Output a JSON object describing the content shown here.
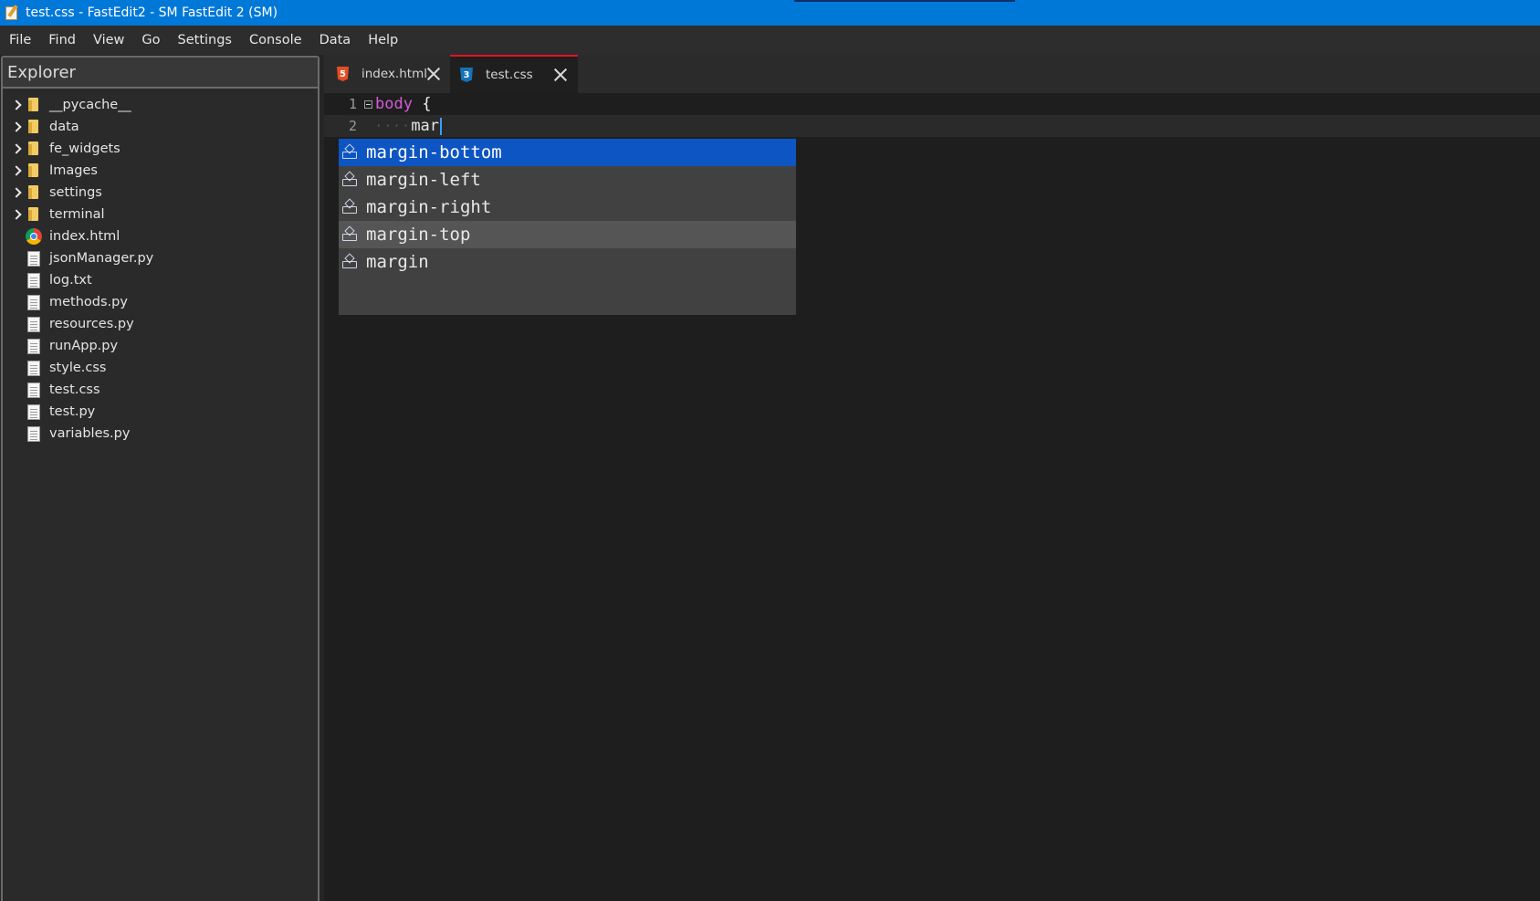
{
  "window": {
    "title": "test.css - FastEdit2 - SM FastEdit 2 (SM)",
    "title_bar_color": "#0078d7"
  },
  "menu": {
    "items": [
      "File",
      "Find",
      "View",
      "Go",
      "Settings",
      "Console",
      "Data",
      "Help"
    ]
  },
  "explorer": {
    "title": "Explorer",
    "folders": [
      "__pycache__",
      "data",
      "fe_widgets",
      "Images",
      "settings",
      "terminal"
    ],
    "files": [
      {
        "name": "index.html",
        "icon": "chrome-icon"
      },
      {
        "name": "jsonManager.py",
        "icon": "file-icon"
      },
      {
        "name": "log.txt",
        "icon": "file-icon"
      },
      {
        "name": "methods.py",
        "icon": "file-icon"
      },
      {
        "name": "resources.py",
        "icon": "file-icon"
      },
      {
        "name": "runApp.py",
        "icon": "file-icon"
      },
      {
        "name": "style.css",
        "icon": "file-icon"
      },
      {
        "name": "test.css",
        "icon": "file-icon"
      },
      {
        "name": "test.py",
        "icon": "file-icon"
      },
      {
        "name": "variables.py",
        "icon": "file-icon"
      }
    ]
  },
  "tabs": [
    {
      "label": "index.html",
      "icon": "html5-icon",
      "active": false
    },
    {
      "label": "test.css",
      "icon": "css3-icon",
      "active": true
    }
  ],
  "editor": {
    "lines": [
      {
        "number": "1",
        "selector": "body",
        "brace": "{"
      },
      {
        "number": "2",
        "indent": "····",
        "text": "mar"
      }
    ]
  },
  "autocomplete": {
    "items": [
      "margin-bottom",
      "margin-left",
      "margin-right",
      "margin-top",
      "margin"
    ],
    "selected_index": 0,
    "hover_index": 3,
    "selected_color": "#0d55c2"
  },
  "icons": {
    "html_tab_glyph": "5",
    "css_tab_glyph": "3"
  }
}
